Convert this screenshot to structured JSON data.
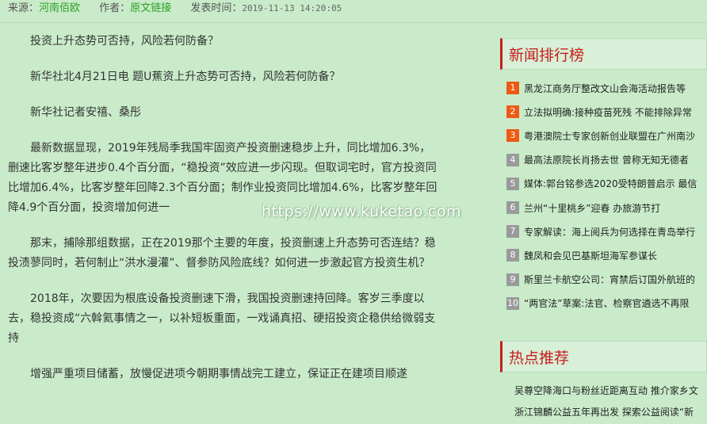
{
  "meta": {
    "source_label": "来源：",
    "source_value": "河南佰欧",
    "author_label": "作者：",
    "author_value": "原文链接",
    "time_label": "发表时间：",
    "time_value": "2019-11-13 14:20:05"
  },
  "article": {
    "paragraphs": [
      "投资上升态势可否持，风险若何防备？",
      "新华社北4月21日电 题U蕉资上升态势可否持，风险若何防备？",
      "新华社记者安禧、桑彤",
      "最新数据显现，2019年残局季我国牢固资产投资删速稳步上升，同比增加6.3%，删速比客岁整年进步0.4个百分面，“稳投资”效应进一步闪现。但取词宅时，官方投资同比增加6.4%，比客岁整年回降2.3个百分面；制作业投资同比增加4.6%，比客岁整年回降4.9个百分面，投资增加何进一",
      "那末，捕除那组数据，正在2019那个主要的年度，投资删速上升态势可否连结？稳投渍蓼同时，若何制止“洪水漫灌”、督参防风险底线？如何进一步激起官方投资生机？",
      "2018年，次要因为根底设备投资删速下滑，我国投资删速持回降。客岁三季度以去，稳投资成“六斡氦事情之一，以补短板重面，一戏诵真招、硬招投资企稳供给微弱支持",
      "增强严重项目储蓄，放慢促进项今朝期事情战完工建立，保证正在建项目顺遂"
    ]
  },
  "watermark": "https://www.kuketao.com",
  "ranking": {
    "title": "新闻排行榜",
    "items": [
      {
        "num": "1",
        "text": "黑龙江商务厅整改文山会海活动报告等"
      },
      {
        "num": "2",
        "text": "立法拟明确:接种疫苗死残 不能排除异常"
      },
      {
        "num": "3",
        "text": "粤港澳院士专家创新创业联盟在广州南沙"
      },
      {
        "num": "4",
        "text": "最高法原院长肖扬去世 曾称无知无德者"
      },
      {
        "num": "5",
        "text": "媒体:郭台铭参选2020受特朗普启示 最信"
      },
      {
        "num": "6",
        "text": "兰州“十里桃乡”迎春 办旅游节打"
      },
      {
        "num": "7",
        "text": "专家解读：海上阅兵为何选择在青岛举行"
      },
      {
        "num": "8",
        "text": "魏凤和会见巴基斯坦海军参谋长"
      },
      {
        "num": "9",
        "text": "斯里兰卡航空公司：宵禁后订国外航班的"
      },
      {
        "num": "10",
        "text": "“两官法”草案:法官、检察官遴选不再限"
      }
    ]
  },
  "hot": {
    "title": "热点推荐",
    "items": [
      "吴尊空降海口与粉丝近距离互动 推介家乡文",
      "浙江锦麟公益五年再出发 探索公益阅读“新"
    ]
  },
  "colors": {
    "background": "#c9ebc9",
    "accent_red": "#c81d1d",
    "rank_hot": "#ee5a14",
    "rank_cold": "#9a9a9a",
    "link_green": "#2aa02a"
  }
}
